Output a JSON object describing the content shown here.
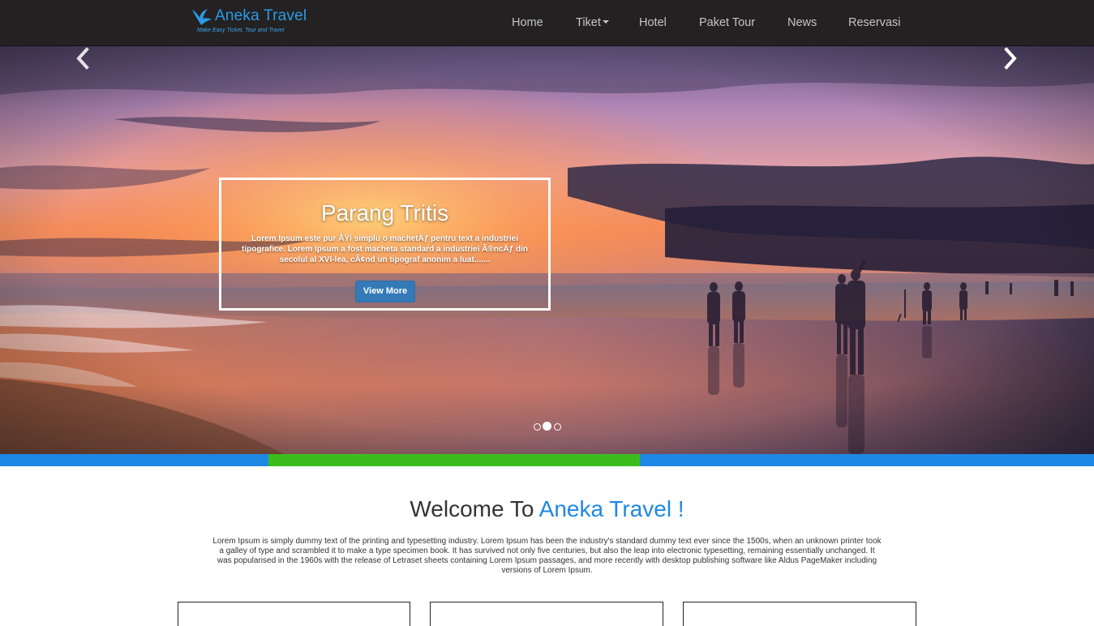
{
  "brand": {
    "name": "Aneka Travel",
    "tagline": "Make Easy Ticket, Tour and Travel",
    "logo_icon": "bird-icon",
    "color": "#2b9be6"
  },
  "nav": {
    "items": [
      {
        "label": "Home"
      },
      {
        "label": "Tiket",
        "has_dropdown": true
      },
      {
        "label": "Hotel"
      },
      {
        "label": "Paket Tour"
      },
      {
        "label": "News"
      },
      {
        "label": "Reservasi"
      }
    ]
  },
  "carousel": {
    "slide_title": "Parang Tritis",
    "slide_text": "Lorem Ipsum este pur ÅŸi simplu o machetÄƒ pentru text a industriei tipografice. Lorem Ipsum a fost macheta standard a industriei Ã®ncÄƒ din secolul al XVI-lea, cÃ¢nd un tipograf anonim a luat.......",
    "button_label": "View More",
    "prev_icon": "chevron-left-icon",
    "next_icon": "chevron-right-icon",
    "slide_count": 3,
    "active_index": 1
  },
  "stripe_colors": [
    "#1e88e5",
    "#3dbd1d",
    "#1e88e5"
  ],
  "welcome": {
    "title_prefix": "Welcome To ",
    "title_accent": "Aneka Travel !",
    "accent_color": "#1e88e5",
    "text": "Lorem Ipsum is simply dummy text of the printing and typesetting industry. Lorem Ipsum has been the industry's standard dummy text ever since the 1500s, when an unknown printer took a galley of type and scrambled it to make a type specimen book. It has survived not only five centuries, but also the leap into electronic typesetting, remaining essentially unchanged. It was popularised in the 1960s with the release of Letraset sheets containing Lorem Ipsum passages, and more recently with desktop publishing software like Aldus PageMaker including versions of Lorem Ipsum."
  }
}
